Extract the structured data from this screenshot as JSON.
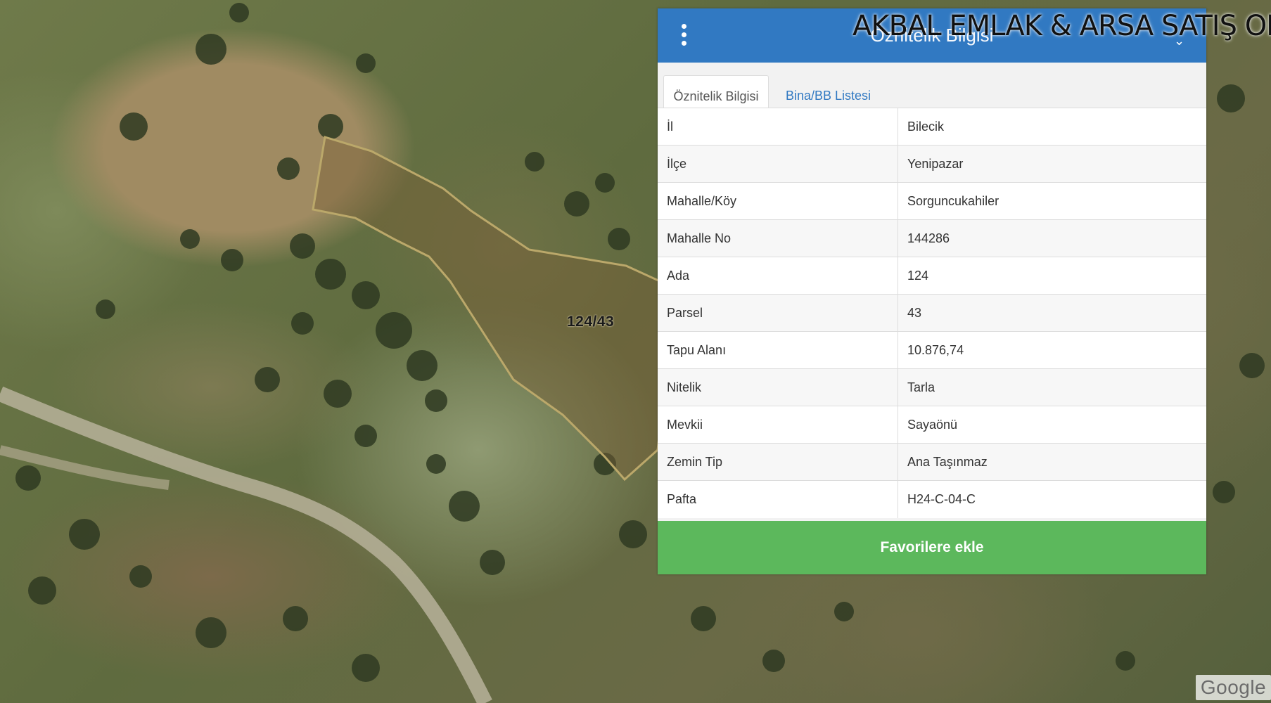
{
  "map": {
    "parcel_label": "124/43",
    "logo_text": "Google"
  },
  "watermark": "AKBAL EMLAK & ARSA SATIŞ OFİSİ",
  "panel": {
    "title": "Öznitelik Bilgisi",
    "tabs": [
      {
        "label": "Öznitelik Bilgisi",
        "active": true
      },
      {
        "label": "Bina/BB Listesi",
        "active": false
      }
    ],
    "rows": [
      {
        "key": "İl",
        "value": "Bilecik"
      },
      {
        "key": "İlçe",
        "value": "Yenipazar"
      },
      {
        "key": "Mahalle/Köy",
        "value": "Sorguncukahiler"
      },
      {
        "key": "Mahalle No",
        "value": "144286"
      },
      {
        "key": "Ada",
        "value": "124"
      },
      {
        "key": "Parsel",
        "value": "43"
      },
      {
        "key": "Tapu Alanı",
        "value": "10.876,74"
      },
      {
        "key": "Nitelik",
        "value": "Tarla"
      },
      {
        "key": "Mevkii",
        "value": "Sayaönü"
      },
      {
        "key": "Zemin Tip",
        "value": "Ana Taşınmaz"
      },
      {
        "key": "Pafta",
        "value": "H24-C-04-C"
      }
    ],
    "favorite_button": "Favorilere ekle"
  },
  "colors": {
    "header": "#3179c2",
    "button": "#5cb85c",
    "parcel_outline": "#bba86a"
  }
}
